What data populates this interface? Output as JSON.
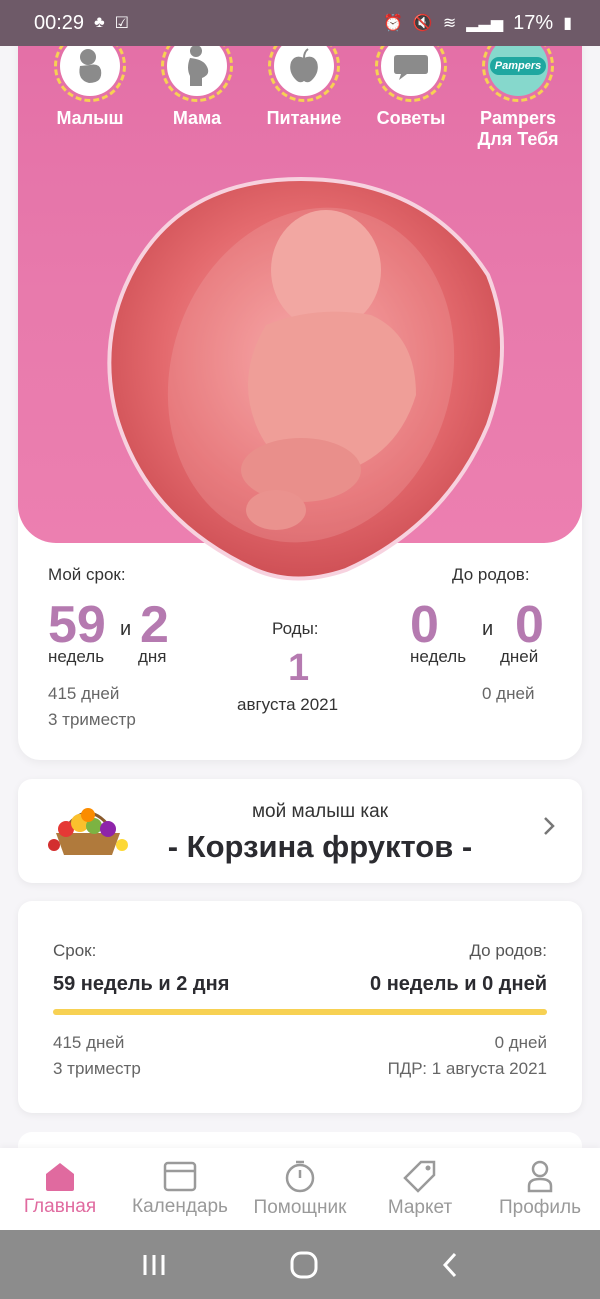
{
  "status": {
    "time": "00:29",
    "battery": "17%"
  },
  "topnav": [
    {
      "label": "Малыш",
      "icon": "baby-icon"
    },
    {
      "label": "Мама",
      "icon": "pregnant-woman-icon"
    },
    {
      "label": "Питание",
      "icon": "apple-icon"
    },
    {
      "label": "Советы",
      "icon": "chat-bubble-icon"
    },
    {
      "label": "Pampers\nДля Тебя",
      "icon": "pampers-logo"
    }
  ],
  "brand_logo_text": "Pampers",
  "my_term": {
    "label": "Мой срок:",
    "weeks": "59",
    "and": "и",
    "days": "2",
    "weeks_unit": "недель",
    "days_unit": "дня",
    "total_days": "415 дней",
    "trimester": "3 триместр"
  },
  "birth": {
    "label": "Роды:",
    "day": "1",
    "month_year": "августа 2021"
  },
  "until_birth": {
    "label": "До родов:",
    "weeks": "0",
    "and": "и",
    "days": "0",
    "weeks_unit": "недель",
    "days_unit": "дней",
    "total_days": "0 дней"
  },
  "fruit": {
    "subtitle": "мой малыш как",
    "title": "- Корзина фруктов -"
  },
  "term_card": {
    "term_label": "Срок:",
    "term_value": "59 недель и 2 дня",
    "until_label": "До родов:",
    "until_value": "0 недель и 0 дней",
    "progress": 1.0,
    "total_days": "415 дней",
    "trimester": "3 триместр",
    "until_days": "0 дней",
    "due_date": "ПДР: 1 августа 2021"
  },
  "tabs": [
    {
      "label": "Главная",
      "icon": "home-icon",
      "active": true
    },
    {
      "label": "Календарь",
      "icon": "calendar-icon",
      "active": false
    },
    {
      "label": "Помощник",
      "icon": "timer-icon",
      "active": false
    },
    {
      "label": "Маркет",
      "icon": "tag-icon",
      "active": false
    },
    {
      "label": "Профиль",
      "icon": "profile-icon",
      "active": false
    }
  ],
  "colors": {
    "pink": "#e36ea6",
    "accent_purple": "#b57ab0",
    "progress_yellow": "#f7d153",
    "active_tab": "#e06a9f"
  }
}
